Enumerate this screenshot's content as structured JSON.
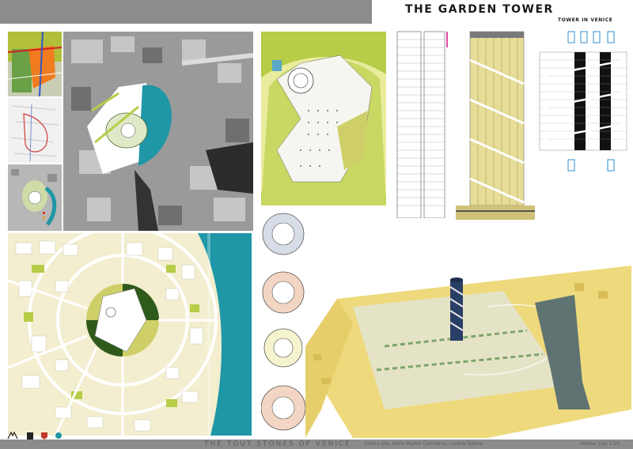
{
  "header": {
    "title": "THE GARDEN TOWER",
    "subtitle": "TOWER IN VENICE"
  },
  "footer": {
    "project": "THE TOUT STONES OF VENICE",
    "authors": "Chiara Qiu, Dario Martin Canclemo, Lorena Todaro",
    "meta": "Venice, July 1:20"
  },
  "colors": {
    "bar": "#8c8c8c",
    "water": "#1f97a6",
    "green": "#b7cc47",
    "dark_green": "#2e5a1c",
    "cream": "#f3eecf",
    "model_yellow": "#eed97c",
    "olive": "#cfcf6a"
  },
  "icons": [
    "logo-mark",
    "logo-tower",
    "logo-shield",
    "logo-drop"
  ]
}
